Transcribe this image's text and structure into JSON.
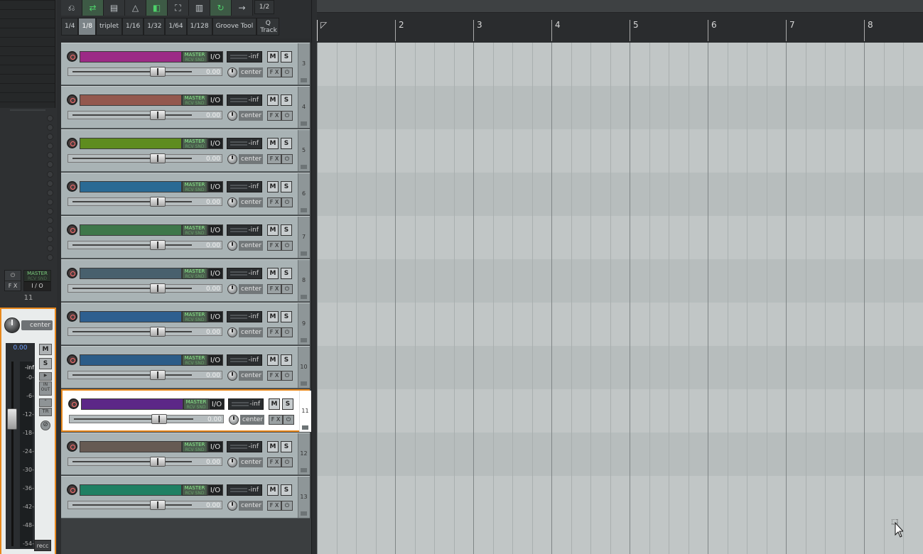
{
  "toolbar": {
    "row1_icons": [
      "ripple-icon",
      "auto-crossfade-icon",
      "envelope-icon",
      "metronome-icon",
      "snap-icon",
      "lock-icon",
      "grid-icon",
      "loop-icon",
      "arrow-icon"
    ],
    "half_label": "1/2",
    "grid": [
      "1/4",
      "1/8",
      "triplet",
      "1/16",
      "1/32",
      "1/64",
      "1/128",
      "Groove Tool"
    ],
    "q_track": "Q Track",
    "selected_grid": "1/8"
  },
  "mixer": {
    "fx_label": "F X",
    "power_label": "⏻",
    "master_label": "MASTER",
    "rcv_label": "RCV SND",
    "io_label": "I / O",
    "track_number": "11",
    "pan_label": "center",
    "volume": "0.00",
    "meter_peak": "-inf",
    "mute": "M",
    "solo": "S",
    "scale": [
      "-0-",
      "-6-",
      "-12-",
      "-18-",
      "-24-",
      "-30-",
      "-36-",
      "-42-",
      "-48-",
      "-54-"
    ],
    "in_out": "IN OUT",
    "trim": "TR",
    "rec_tab": "recc"
  },
  "track_common": {
    "master": "MASTER",
    "rcv": "RCV SND",
    "io": "I/O",
    "vu": "-inf",
    "mute": "M",
    "solo": "S",
    "volume": "0.00",
    "pan": "center",
    "fx": "F X",
    "power": "⏻"
  },
  "tracks": [
    {
      "number": "3",
      "color": "#9c2a86"
    },
    {
      "number": "4",
      "color": "#93584e"
    },
    {
      "number": "5",
      "color": "#5e8c1f"
    },
    {
      "number": "6",
      "color": "#2a6a94"
    },
    {
      "number": "7",
      "color": "#3e774a"
    },
    {
      "number": "8",
      "color": "#48606d"
    },
    {
      "number": "9",
      "color": "#2e5f8f"
    },
    {
      "number": "10",
      "color": "#2b5c88"
    },
    {
      "number": "11",
      "color": "#5c2787",
      "selected": true
    },
    {
      "number": "12",
      "color": "#665a53"
    },
    {
      "number": "13",
      "color": "#1f8063"
    }
  ],
  "ruler": {
    "bars": [
      "2",
      "3",
      "4",
      "5",
      "6",
      "7",
      "8"
    ]
  },
  "colors": {
    "selection": "#e8881c",
    "arrange_bg": "#c1c6c6",
    "toolbar_active": "#4ed16a"
  }
}
